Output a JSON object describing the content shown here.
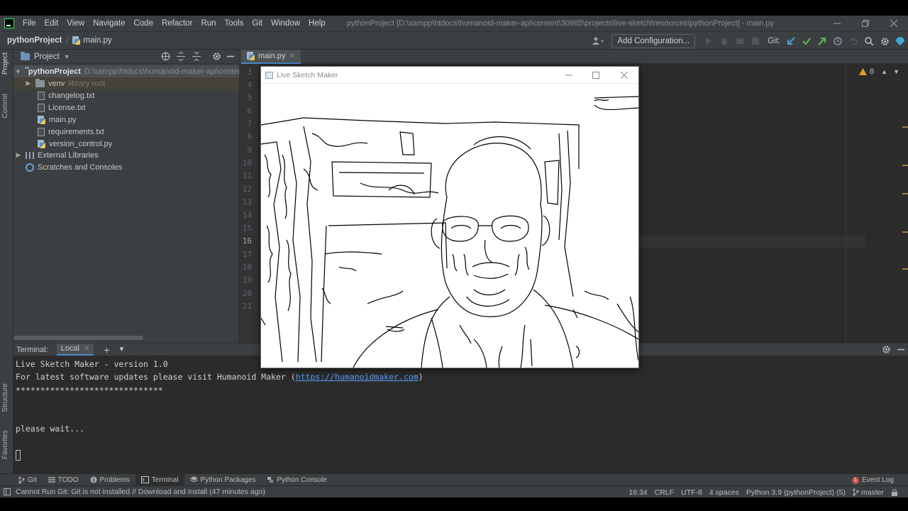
{
  "menu": {
    "items": [
      "File",
      "Edit",
      "View",
      "Navigate",
      "Code",
      "Refactor",
      "Run",
      "Tools",
      "Git",
      "Window",
      "Help"
    ],
    "window_title": "pythonProject [D:\\xampp\\htdocs\\humanoid-maker-api\\content\\30985\\projects\\live-sketch\\resources\\pythonProject] - main.py"
  },
  "navbar": {
    "project": "pythonProject",
    "file": "main.py",
    "add_config": "Add Configuration...",
    "git_label": "Git:"
  },
  "left_strip": {
    "project": "Project",
    "commit": "Commit",
    "structure": "Structure",
    "favorites": "Favorites"
  },
  "project_panel": {
    "title": "Project",
    "root": {
      "name": "pythonProject",
      "path": "D:\\xampp\\htdocs\\humanoid-maker-api\\content\\"
    },
    "venv": {
      "name": "venv",
      "hint": "library root"
    },
    "files": [
      "changelog.txt",
      "License.txt",
      "main.py",
      "requirements.txt",
      "version_control.py"
    ],
    "external": "External Libraries",
    "scratches": "Scratches and Consoles"
  },
  "editor": {
    "tab": "main.py",
    "line_numbers": [
      "3",
      "4",
      "5",
      "6",
      "7",
      "8",
      "9",
      "10",
      "11",
      "12",
      "13",
      "14",
      "15",
      "16",
      "17",
      "18",
      "19",
      "20",
      "21"
    ],
    "current_line": "16",
    "warnings": "8"
  },
  "terminal": {
    "title": "Terminal:",
    "tab": "Local",
    "line1": "Live Sketch Maker - version 1.0",
    "line2_prefix": "For latest software updates please visit Humanoid Maker (",
    "line2_link": "https://humanoidmaker.com",
    "line2_suffix": ")",
    "line3": "******************************",
    "line4": "please wait..."
  },
  "bottom_tools": {
    "git": "Git",
    "todo": "TODO",
    "problems": "Problems",
    "terminal": "Terminal",
    "packages": "Python Packages",
    "console": "Python Console",
    "event_log": "Event Log"
  },
  "status": {
    "message": "Cannot Run Git: Git is not installed // Download and Install (47 minutes ago)",
    "position": "16:34",
    "line_sep": "CRLF",
    "encoding": "UTF-8",
    "indent": "4 spaces",
    "interpreter": "Python 3.9 (pythonProject) (5)",
    "branch": "master"
  },
  "sketch_window": {
    "title": "Live Sketch Maker"
  },
  "colors": {
    "accent": "#4a88c7",
    "panel": "#3c3f41",
    "editor_bg": "#2b2b2b",
    "link": "#589df6"
  }
}
